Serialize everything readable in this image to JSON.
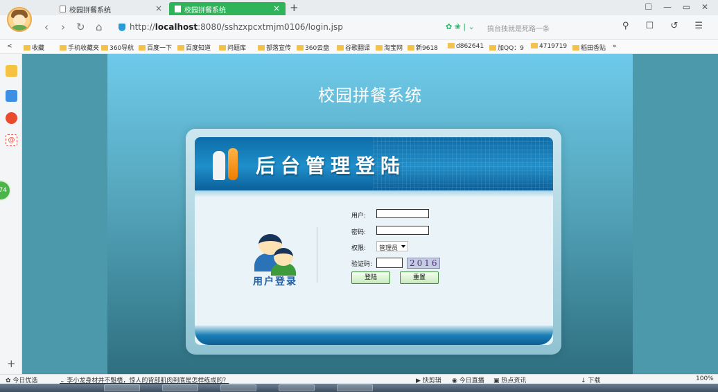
{
  "browser": {
    "tabs": [
      {
        "title": "校园拼餐系统",
        "active": false
      },
      {
        "title": "校园拼餐系统",
        "active": true
      }
    ],
    "new_tab": "+",
    "window_controls": "☐ — ▭ ✕",
    "url_prefix": "http://",
    "url_host": "localhost",
    "url_path": ":8080/sshzxpcxtmjm0106/login.jsp",
    "search_hint": "搞台独就是死路一条",
    "ext_icons": "✿ ❀ | ⌄",
    "right_tools": "⚲ ☐ ↺ ☰"
  },
  "bookmarks": [
    "收藏",
    "手机收藏夹",
    "360导航",
    "百度一下",
    "百度知道",
    "问题库",
    "部落宣传",
    "360云盘",
    "谷歌翻译",
    "淘宝网",
    "新9618",
    "d862641",
    "加QQ：9",
    "4719719",
    "稻田香贴"
  ],
  "sidebar": {
    "bubble": "74",
    "plus": "+"
  },
  "page": {
    "system_title": "校园拼餐系统",
    "header_title": "后台管理登陆",
    "user_login_text": "用户登录",
    "form": {
      "user_label": "用户:",
      "password_label": "密码:",
      "role_label": "权限:",
      "role_value": "管理员",
      "code_label": "验证码:",
      "captcha": "2016",
      "login_button": "登陆",
      "reset_button": "重置"
    }
  },
  "statusbar": {
    "today": "今日优选",
    "news": "李小龙身材并不魁梧，惊人的背部肌肉到底是怎样练成的？",
    "clip": "快剪辑",
    "live": "今日直播",
    "hot": "热点资讯",
    "download": "下载",
    "zoom": "100%"
  }
}
